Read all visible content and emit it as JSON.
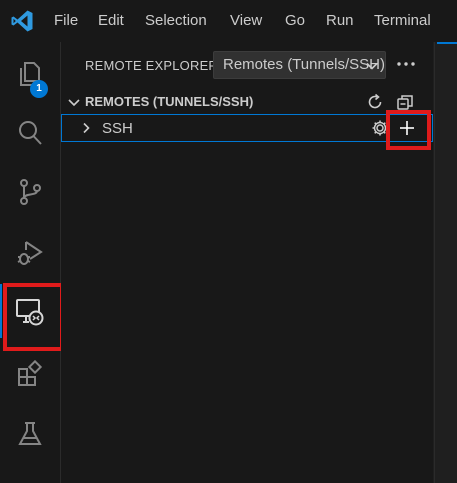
{
  "menu": {
    "items": [
      "File",
      "Edit",
      "Selection",
      "View",
      "Go",
      "Run",
      "Terminal"
    ]
  },
  "activity_bar": {
    "items": [
      {
        "name": "Explorer",
        "icon": "files-icon",
        "badge": "1"
      },
      {
        "name": "Search",
        "icon": "search-icon"
      },
      {
        "name": "Source Control",
        "icon": "source-control-icon"
      },
      {
        "name": "Run and Debug",
        "icon": "run-debug-icon"
      },
      {
        "name": "Remote Explorer",
        "icon": "remote-explorer-icon",
        "active": true
      },
      {
        "name": "Extensions",
        "icon": "extensions-icon"
      },
      {
        "name": "Testing",
        "icon": "testing-flask-icon"
      }
    ]
  },
  "sidebar": {
    "title": "REMOTE EXPLORER",
    "view_select": {
      "value": "Remotes (Tunnels/SSH)"
    },
    "section": {
      "title": "REMOTES (TUNNELS/SSH)",
      "actions": [
        "refresh-icon",
        "collapse-all-icon"
      ]
    },
    "tree": [
      {
        "label": "SSH",
        "actions": [
          "settings-gear-icon",
          "add-plus-icon"
        ]
      }
    ]
  },
  "colors": {
    "accent": "#0078d4",
    "highlight": "#e01b1b",
    "background": "#181818"
  }
}
